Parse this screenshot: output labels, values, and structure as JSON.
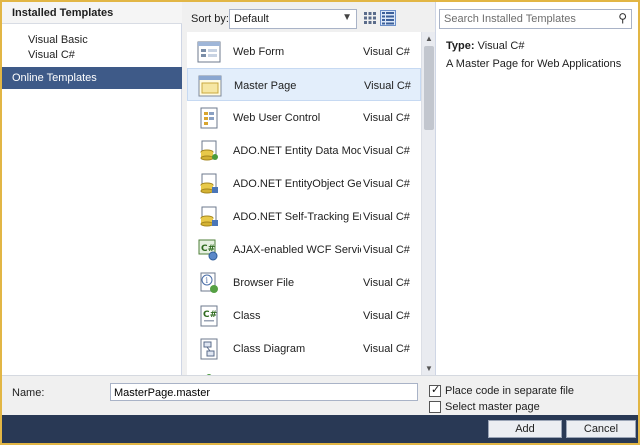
{
  "left": {
    "header": "Installed Templates",
    "items": [
      {
        "label": "Visual Basic"
      },
      {
        "label": "Visual C#"
      }
    ],
    "online": "Online Templates"
  },
  "toolbar": {
    "sort_label": "Sort by:",
    "sort_value": "Default",
    "view_small_icon": "small-icons-view-icon",
    "view_list_icon": "details-view-icon"
  },
  "templates": [
    {
      "name": "Web Form",
      "lang": "Visual C#",
      "icon": "web-form-icon"
    },
    {
      "name": "Master Page",
      "lang": "Visual C#",
      "icon": "master-page-icon",
      "selected": true
    },
    {
      "name": "Web User Control",
      "lang": "Visual C#",
      "icon": "web-user-control-icon"
    },
    {
      "name": "ADO.NET Entity Data Model",
      "lang": "Visual C#",
      "icon": "entity-model-icon"
    },
    {
      "name": "ADO.NET EntityObject Gener...",
      "lang": "Visual C#",
      "icon": "entity-generator-icon"
    },
    {
      "name": "ADO.NET Self-Tracking Entit...",
      "lang": "Visual C#",
      "icon": "self-tracking-icon"
    },
    {
      "name": "AJAX-enabled WCF Service",
      "lang": "Visual C#",
      "icon": "wcf-service-icon"
    },
    {
      "name": "Browser File",
      "lang": "Visual C#",
      "icon": "browser-file-icon"
    },
    {
      "name": "Class",
      "lang": "Visual C#",
      "icon": "class-icon"
    },
    {
      "name": "Class Diagram",
      "lang": "Visual C#",
      "icon": "class-diagram-icon"
    }
  ],
  "details": {
    "search_placeholder": "Search Installed Templates",
    "type_label": "Type:",
    "type_value": "Visual C#",
    "description": "A Master Page for Web Applications"
  },
  "bottom": {
    "name_label": "Name:",
    "name_value": "MasterPage.master",
    "option1": "Place code in separate file",
    "option1_checked": true,
    "option2": "Select master page",
    "option2_checked": false
  },
  "buttons": {
    "add": "Add",
    "cancel": "Cancel"
  },
  "colors": {
    "accent": "#3e5a88",
    "button_bar": "#293955",
    "selection": "#e3eefb",
    "frame": "#e2b645"
  }
}
